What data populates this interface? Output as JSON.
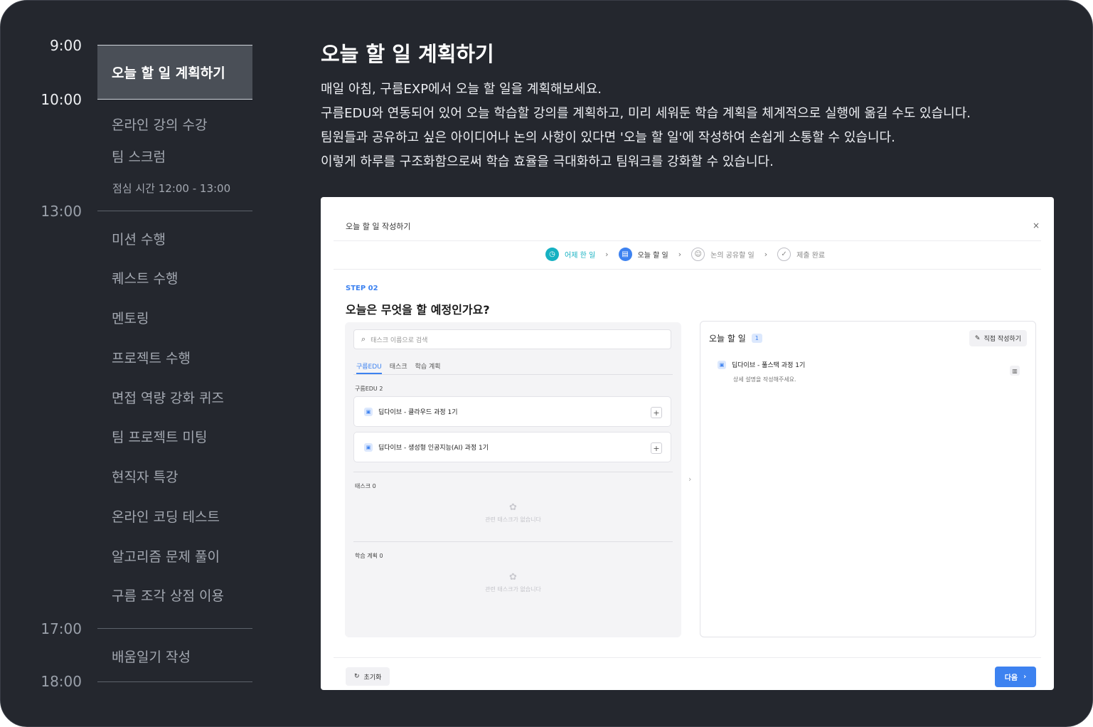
{
  "timeline": {
    "times": [
      "9:00",
      "10:00",
      "13:00",
      "17:00",
      "18:00"
    ],
    "active_item": "오늘 할 일 계획하기",
    "morning_items": [
      "온라인 강의 수강",
      "팀 스크럼"
    ],
    "lunch_note": "점심 시간 12:00 - 13:00",
    "afternoon_items": [
      "미션 수행",
      "퀘스트 수행",
      "멘토링",
      "프로젝트 수행",
      "면접 역량 강화 퀴즈",
      "팀 프로젝트 미팅",
      "현직자 특강",
      "온라인 코딩 테스트",
      "알고리즘 문제 풀이",
      "구름 조각 상점 이용"
    ],
    "evening_item": "배움일기 작성"
  },
  "content": {
    "title": "오늘 할 일 계획하기",
    "lines": [
      "매일 아침, 구름EXP에서 오늘 할 일을 계획해보세요.",
      "구름EDU와 연동되어 있어 오늘 학습할 강의를 계획하고, 미리 세워둔 학습 계획을 체계적으로 실행에 옮길 수도 있습니다.",
      "팀원들과 공유하고 싶은 아이디어나 논의 사항이 있다면 '오늘 할 일'에 작성하여 손쉽게 소통할 수 있습니다.",
      "이렇게 하루를 구조화함으로써 학습 효율을 극대화하고 팀워크를 강화할 수 있습니다."
    ]
  },
  "modal": {
    "title": "오늘 할 일 작성하기",
    "close": "×",
    "steps": [
      "어제 한 일",
      "오늘 할 일",
      "논의 공유할 일",
      "제출 완료"
    ],
    "step_label": "STEP 02",
    "question": "오늘은 무엇을 할 예정인가요?",
    "search_placeholder": "태스크 이름으로 검색",
    "tabs": [
      "구름EDU",
      "태스크",
      "학습 계획"
    ],
    "group_edu": "구름EDU 2",
    "edu_items": [
      "딥다이브 - 클라우드 과정 1기",
      "딥다이브 - 생성형 인공지능(AI) 과정 1기"
    ],
    "group_task": "태스크 0",
    "group_plan": "학습 계획 0",
    "empty_text": "관련 태스크가 없습니다",
    "right_title": "오늘 할 일",
    "right_count": "1",
    "direct_btn": "직접 작성하기",
    "right_item": "딥다이브 - 풀스택 과정 1기",
    "right_item_sub": "상세 설명을 작성해주세요.",
    "reset_btn": "초기화",
    "next_btn": "다음"
  },
  "colors": {
    "background": "#24272e",
    "accent": "#3d82f0",
    "teal": "#16b1c2"
  },
  "icons": {
    "step1": "clock-icon",
    "step2": "document-icon",
    "step3": "people-icon",
    "step4": "check-icon"
  }
}
